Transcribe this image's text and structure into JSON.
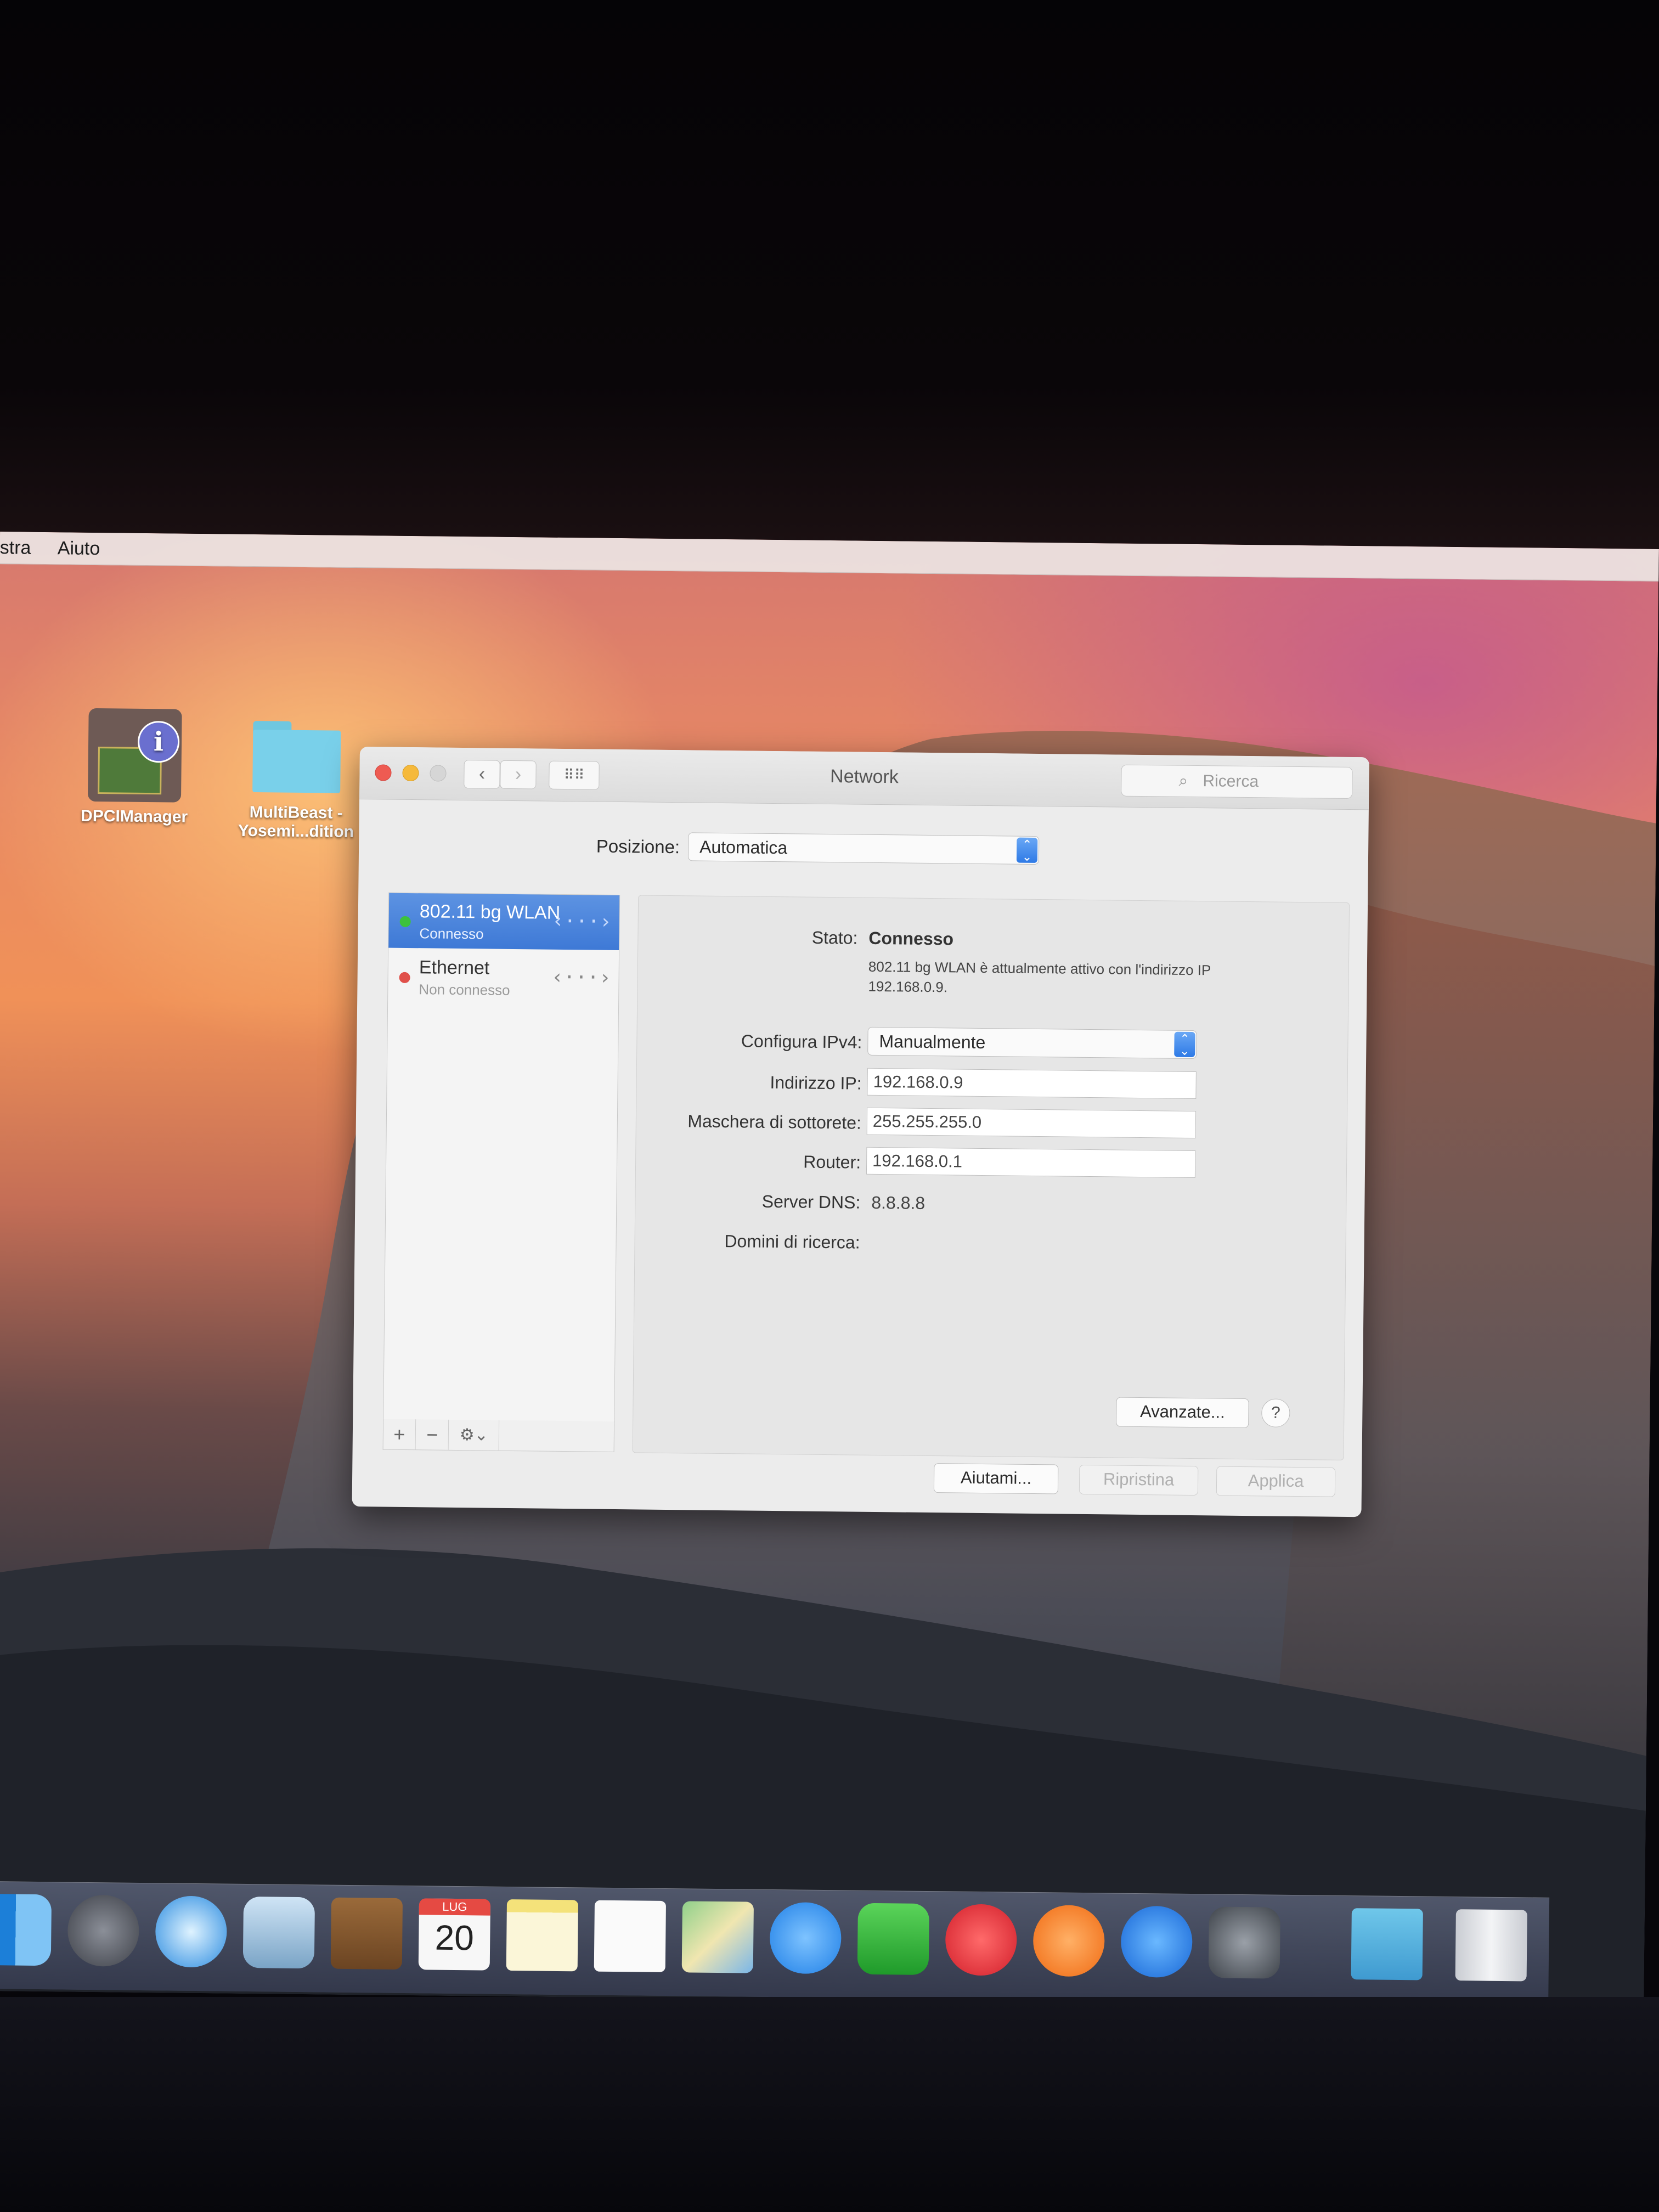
{
  "menubar": {
    "items": [
      "stra",
      "Aiuto"
    ]
  },
  "desktop": {
    "icons": [
      {
        "label": "DPCIManager"
      },
      {
        "label_line1": "MultiBeast -",
        "label_line2": "Yosemi...dition"
      }
    ]
  },
  "window": {
    "title": "Network",
    "search_placeholder": "Ricerca",
    "location": {
      "label": "Posizione:",
      "value": "Automatica"
    },
    "services": [
      {
        "name": "802.11 bg WLAN",
        "status": "Connesso",
        "color": "#3cc23c",
        "selected": true
      },
      {
        "name": "Ethernet",
        "status": "Non connesso",
        "color": "#e0504a",
        "selected": false
      }
    ],
    "sidebar_footer": {
      "add": "+",
      "remove": "−",
      "gear": "⚙⌄"
    },
    "detail": {
      "status_label": "Stato:",
      "status_value": "Connesso",
      "status_desc_line1": "802.11 bg WLAN è attualmente attivo con l'indirizzo IP",
      "status_desc_line2": "192.168.0.9.",
      "configure_label": "Configura IPv4:",
      "configure_value": "Manualmente",
      "ip_label": "Indirizzo IP:",
      "ip_value": "192.168.0.9",
      "mask_label": "Maschera di sottorete:",
      "mask_value": "255.255.255.0",
      "router_label": "Router:",
      "router_value": "192.168.0.1",
      "dns_label": "Server DNS:",
      "dns_value": "8.8.8.8",
      "search_domains_label": "Domini di ricerca:"
    },
    "buttons": {
      "advanced": "Avanzate...",
      "help": "?",
      "assist": "Aiutami...",
      "revert": "Ripristina",
      "apply": "Applica"
    }
  },
  "dock": {
    "calendar": {
      "month": "LUG",
      "day": "20"
    },
    "icons": [
      "finder-icon",
      "launchpad-icon",
      "safari-icon",
      "mail-icon",
      "contacts-icon",
      "calendar-icon",
      "notes-icon",
      "reminders-icon",
      "maps-icon",
      "messages-icon",
      "facetime-icon",
      "itunes-icon",
      "ibooks-icon",
      "app-store-icon",
      "system-preferences-icon",
      "downloads-folder-icon",
      "trash-icon"
    ]
  },
  "colors": {
    "accent": "#3e79d6",
    "window_bg": "#ececec"
  }
}
